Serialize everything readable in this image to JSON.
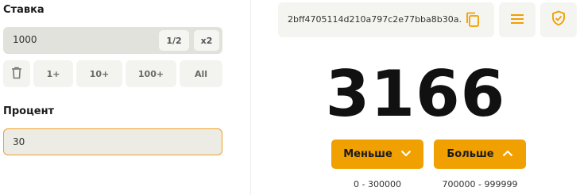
{
  "stake": {
    "label": "Ставка",
    "value": "1000",
    "half_label": "1/2",
    "double_label": "x2"
  },
  "quick_add": {
    "chips": [
      "1+",
      "10+",
      "100+",
      "All"
    ]
  },
  "percent": {
    "label": "Процент",
    "value": "30"
  },
  "hash": {
    "text": "2bff4705114d210a797c2e77bba8b30a..."
  },
  "result": {
    "number": "3166"
  },
  "bets": {
    "less_label": "Меньше",
    "less_range": "0 - 300000",
    "more_label": "Больше",
    "more_range": "700000 - 999999"
  },
  "colors": {
    "accent": "#f0a000",
    "field_bg": "#e2e2dc",
    "chip_bg": "#f3f3ef",
    "focus_border": "#eea12a"
  },
  "icons": {
    "trash": "trash-icon",
    "copy": "copy-icon",
    "menu": "menu-icon",
    "shield": "shield-check-icon",
    "chevron_down": "chevron-down-icon",
    "chevron_up": "chevron-up-icon"
  }
}
